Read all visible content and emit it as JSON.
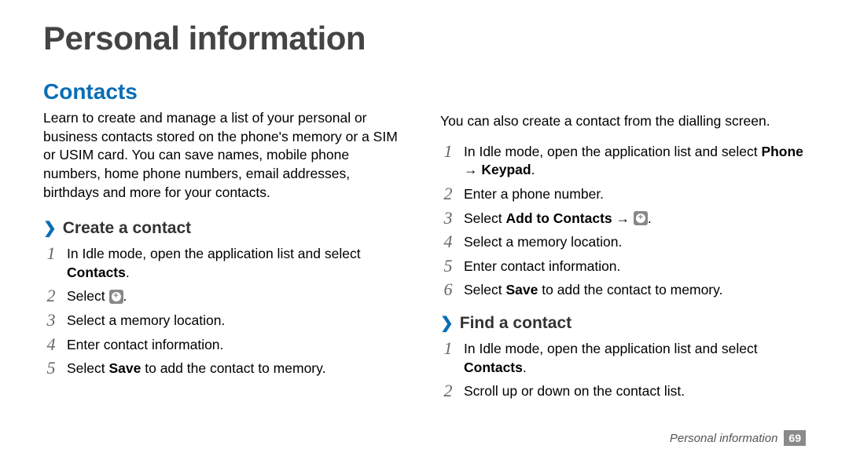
{
  "page_title": "Personal information",
  "left": {
    "section_heading": "Contacts",
    "intro": "Learn to create and manage a list of your personal or business contacts stored on the phone's memory or a SIM or USIM card. You can save names, mobile phone numbers, home phone numbers, email addresses, birthdays and more for your contacts.",
    "sub_heading": "Create a contact",
    "steps": {
      "s1_a": "In Idle mode, open the application list and select ",
      "s1_b": "Contacts",
      "s1_c": ".",
      "s2_a": "Select ",
      "s2_b": ".",
      "s3": "Select a memory location.",
      "s4": "Enter contact information.",
      "s5_a": "Select ",
      "s5_b": "Save",
      "s5_c": " to add the contact to memory."
    }
  },
  "right": {
    "lead": "You can also create a contact from the dialling screen.",
    "steps_a": {
      "s1_a": "In Idle mode, open the application list and select ",
      "s1_b": "Phone",
      "s1_c": " → ",
      "s1_d": "Keypad",
      "s1_e": ".",
      "s2": "Enter a phone number.",
      "s3_a": "Select ",
      "s3_b": "Add to Contacts",
      "s3_c": " → ",
      "s3_d": ".",
      "s4": "Select a memory location.",
      "s5": "Enter contact information.",
      "s6_a": "Select ",
      "s6_b": "Save",
      "s6_c": " to add the contact to memory."
    },
    "sub_heading": "Find a contact",
    "steps_b": {
      "s1_a": "In Idle mode, open the application list and select ",
      "s1_b": "Contacts",
      "s1_c": ".",
      "s2": "Scroll up or down on the contact list."
    }
  },
  "footer": {
    "label": "Personal information",
    "page": "69"
  },
  "nums": {
    "n1": "1",
    "n2": "2",
    "n3": "3",
    "n4": "4",
    "n5": "5",
    "n6": "6"
  }
}
